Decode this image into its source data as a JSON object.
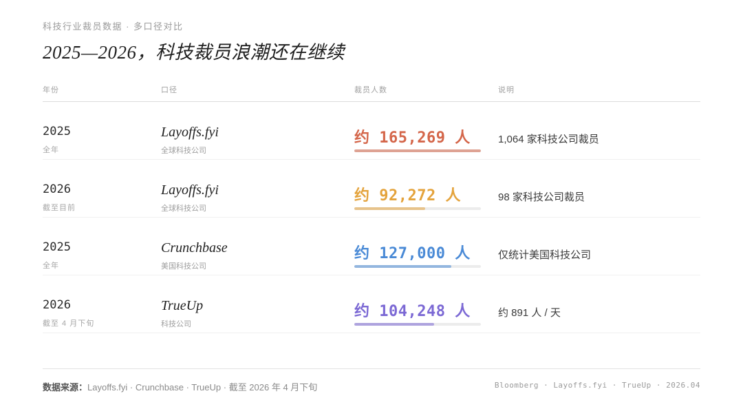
{
  "header": {
    "kicker": "科技行业裁员数据 · 多口径对比",
    "title": "2025—2026，科技裁员浪潮还在继续"
  },
  "table": {
    "columns": [
      "年份",
      "口径",
      "裁员人数",
      "说明"
    ]
  },
  "chart_data": {
    "type": "table",
    "title": "2025—2026，科技裁员浪潮还在继续",
    "rows": [
      {
        "year": "2025",
        "period": "全年",
        "source": "Layoffs.fyi",
        "scope": "全球科技公司",
        "value": 165269,
        "display": "约 165,269 人",
        "note": "1,064 家科技公司裁员",
        "color": "#d4664a"
      },
      {
        "year": "2026",
        "period": "截至目前",
        "source": "Layoffs.fyi",
        "scope": "全球科技公司",
        "value": 92272,
        "display": "约 92,272 人",
        "note": "98 家科技公司裁员",
        "color": "#e4a33c"
      },
      {
        "year": "2025",
        "period": "全年",
        "source": "Crunchbase",
        "scope": "美国科技公司",
        "value": 127000,
        "display": "约 127,000 人",
        "note": "仅统计美国科技公司",
        "color": "#4a8ad6"
      },
      {
        "year": "2026",
        "period": "截至 4 月下旬",
        "source": "TrueUp",
        "scope": "科技公司",
        "value": 104248,
        "display": "约 104,248 人",
        "note": "约 891 人 / 天",
        "color": "#7b68d4"
      }
    ]
  },
  "footer": {
    "source_label": "数据来源：",
    "source_text": "Layoffs.fyi · Crunchbase · TrueUp · 截至 2026 年 4 月下旬",
    "credits": "Bloomberg · Layoffs.fyi · TrueUp · 2026.04"
  }
}
